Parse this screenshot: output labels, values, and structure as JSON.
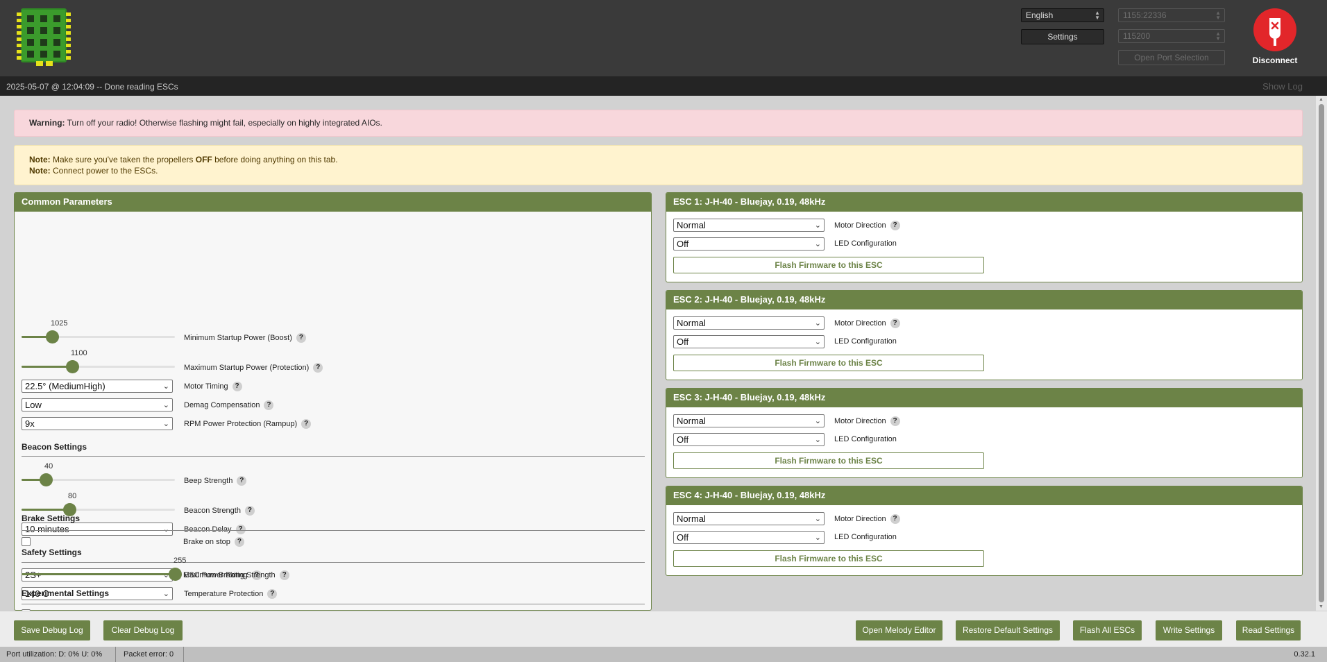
{
  "header": {
    "language": "English",
    "settings_label": "Settings",
    "port": "1155:22336",
    "baud": "115200",
    "open_port_label": "Open Port Selection",
    "disconnect_label": "Disconnect"
  },
  "status": {
    "message": "2025-05-07 @ 12:04:09 -- Done reading ESCs",
    "show_log": "Show Log"
  },
  "warning": {
    "strong": "Warning:",
    "text": " Turn off your radio! Otherwise flashing might fail, especially on highly integrated AIOs."
  },
  "notes": {
    "note1_strong": "Note:",
    "note1_pre": " Make sure you've taken the propellers ",
    "note1_bold": "OFF",
    "note1_post": " before doing anything on this tab.",
    "note2_strong": "Note:",
    "note2_text": " Connect power to the ESCs."
  },
  "common": {
    "title": "Common Parameters",
    "min_startup": {
      "value": "1025",
      "label": "Minimum Startup Power (Boost)",
      "fraction": 0.2
    },
    "max_startup": {
      "value": "1100",
      "label": "Maximum Startup Power (Protection)",
      "fraction": 0.33
    },
    "motor_timing": {
      "value": "22.5° (MediumHigh)",
      "label": "Motor Timing"
    },
    "demag": {
      "value": "Low",
      "label": "Demag Compensation"
    },
    "rpm_protection": {
      "value": "9x",
      "label": "RPM Power Protection (Rampup)"
    },
    "beacon_title": "Beacon Settings",
    "beep_strength": {
      "value": "40",
      "label": "Beep Strength",
      "fraction": 0.16
    },
    "beacon_strength": {
      "value": "80",
      "label": "Beacon Strength",
      "fraction": 0.31
    },
    "beacon_delay": {
      "value": "10 minutes",
      "label": "Beacon Delay"
    },
    "safety_title": "Safety Settings",
    "esc_power_rating": {
      "value": "2S+",
      "label": "ESC Power Rating"
    },
    "temp_protection": {
      "value": "140 C",
      "label": "Temperature Protection"
    },
    "brake_title": "Brake Settings",
    "brake_on_stop": {
      "label": "Brake on stop",
      "checked": false
    },
    "max_braking": {
      "value": "255",
      "label": "Maximum Braking Strength",
      "fraction": 1.0
    },
    "experimental_title": "Experimental Settings"
  },
  "escs": [
    {
      "title": "ESC 1: J-H-40 - Bluejay, 0.19, 48kHz",
      "direction": "Normal",
      "direction_label": "Motor Direction",
      "led": "Off",
      "led_label": "LED Configuration",
      "flash_label": "Flash Firmware to this ESC"
    },
    {
      "title": "ESC 2: J-H-40 - Bluejay, 0.19, 48kHz",
      "direction": "Normal",
      "direction_label": "Motor Direction",
      "led": "Off",
      "led_label": "LED Configuration",
      "flash_label": "Flash Firmware to this ESC"
    },
    {
      "title": "ESC 3: J-H-40 - Bluejay, 0.19, 48kHz",
      "direction": "Normal",
      "direction_label": "Motor Direction",
      "led": "Off",
      "led_label": "LED Configuration",
      "flash_label": "Flash Firmware to this ESC"
    },
    {
      "title": "ESC 4: J-H-40 - Bluejay, 0.19, 48kHz",
      "direction": "Normal",
      "direction_label": "Motor Direction",
      "led": "Off",
      "led_label": "LED Configuration",
      "flash_label": "Flash Firmware to this ESC"
    }
  ],
  "bottom": {
    "save_debug": "Save Debug Log",
    "clear_debug": "Clear Debug Log",
    "melody_editor": "Open Melody Editor",
    "restore_defaults": "Restore Default Settings",
    "flash_all": "Flash All ESCs",
    "write_settings": "Write Settings",
    "read_settings": "Read Settings"
  },
  "footer": {
    "port_util": "Port utilization: D: 0% U: 0%",
    "packet_error": "Packet error: 0",
    "version": "0.32.1"
  },
  "colors": {
    "accent": "#6c8347",
    "header_bg": "#3a3a3a",
    "disconnect": "#e2262a"
  },
  "icons": {
    "logo": "esc-board-logo-icon",
    "disconnect": "usb-disconnect-icon",
    "help": "help-icon"
  }
}
